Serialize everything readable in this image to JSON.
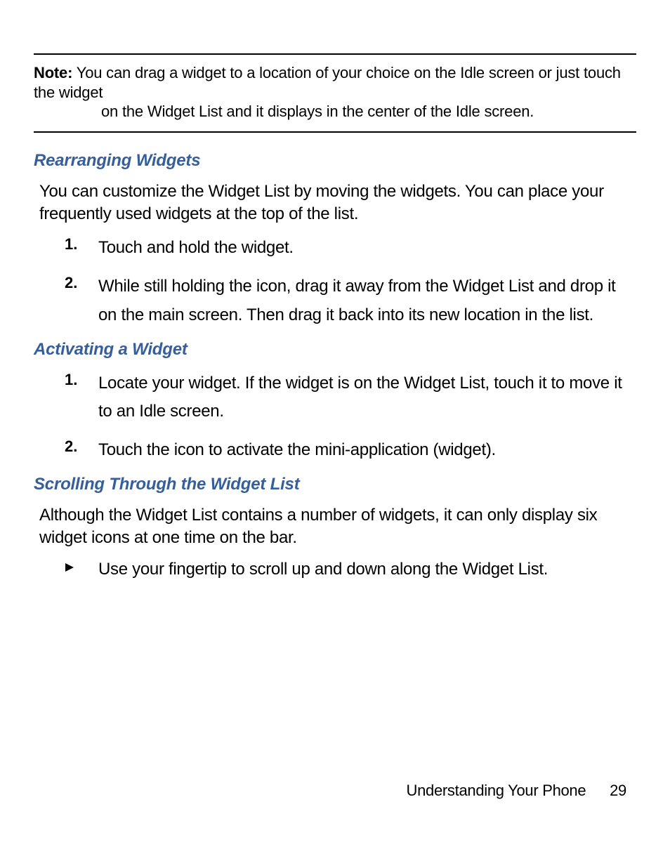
{
  "note": {
    "label": "Note:",
    "line1": " You can drag a widget to a location of your choice on the Idle screen or just touch the widget",
    "line2": "on the Widget List and it displays in the center of the Idle screen."
  },
  "sections": {
    "rearranging": {
      "heading": "Rearranging Widgets",
      "intro": "You can customize the Widget List by moving the widgets. You can place your frequently used widgets at the top of the list.",
      "steps": [
        {
          "num": "1.",
          "text": "Touch and hold the widget."
        },
        {
          "num": "2.",
          "text": "While still holding the icon, drag it away from the Widget List and drop it on the main screen. Then drag it back into its new location in the list."
        }
      ]
    },
    "activating": {
      "heading": "Activating a Widget",
      "steps": [
        {
          "num": "1.",
          "text": "Locate your widget. If the widget is on the Widget List, touch it to move it to an Idle screen."
        },
        {
          "num": "2.",
          "text": "Touch the icon to activate the mini-application (widget)."
        }
      ]
    },
    "scrolling": {
      "heading": "Scrolling Through the Widget List",
      "intro": "Although the Widget List contains a number of widgets, it can only display six widget icons at one time on the bar.",
      "bullets": [
        "Use your fingertip to scroll up and down along the Widget List."
      ]
    }
  },
  "footer": {
    "section_name": "Understanding Your Phone",
    "page": "29"
  }
}
